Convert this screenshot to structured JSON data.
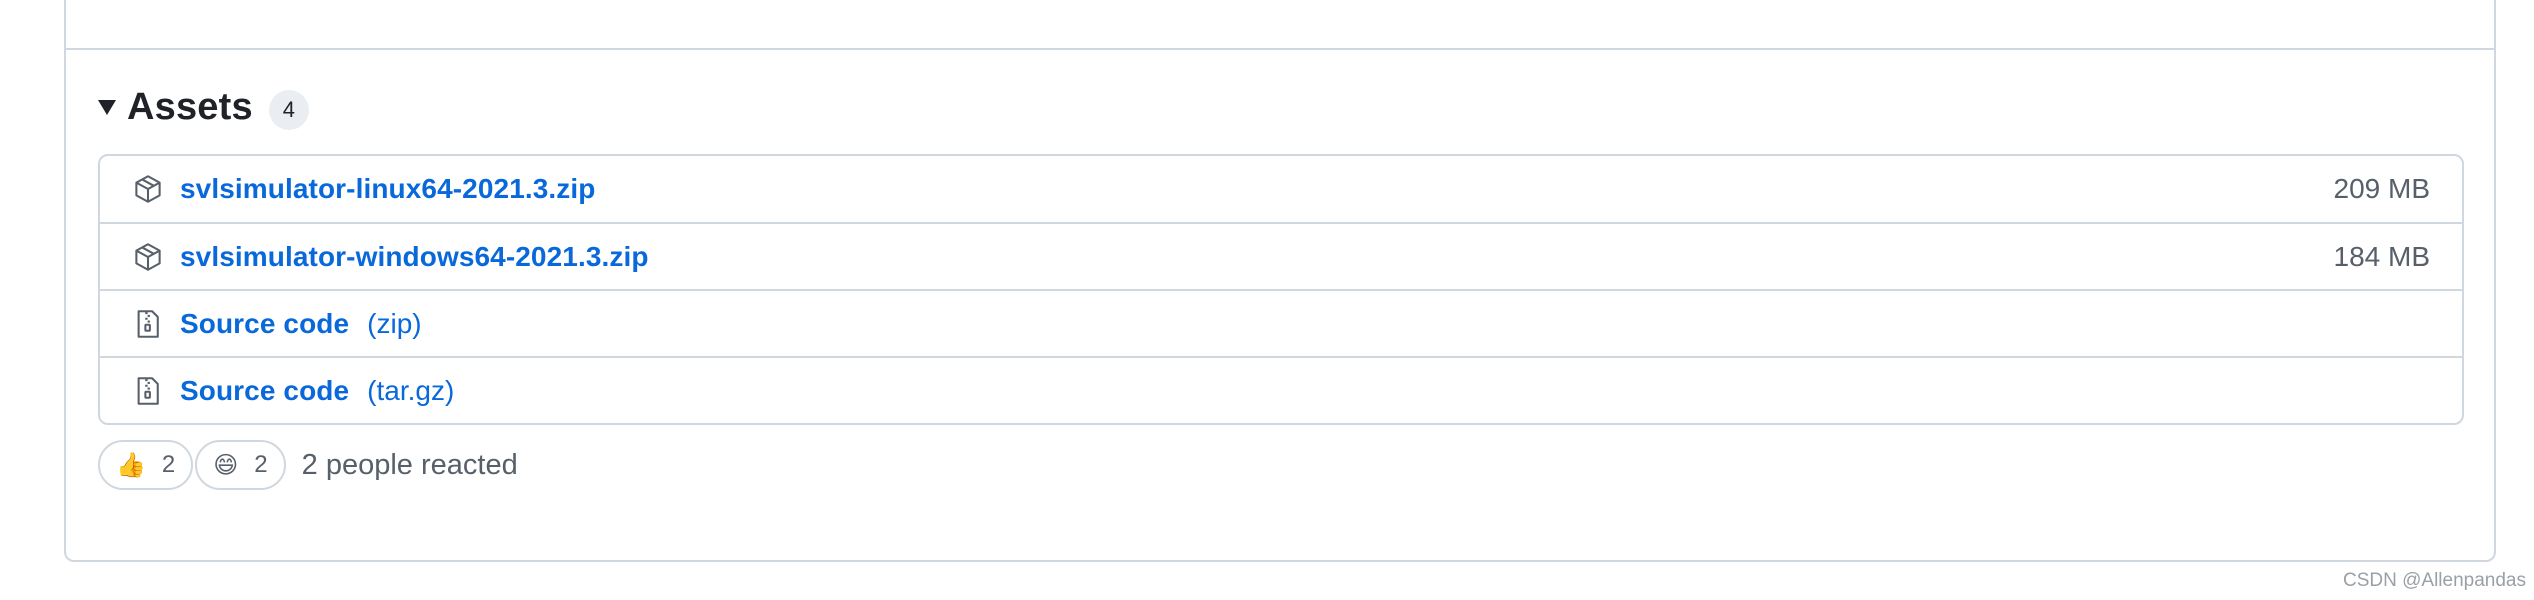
{
  "assets": {
    "title": "Assets",
    "count": "4",
    "items": [
      {
        "name": "svlsimulator-linux64-2021.3.zip",
        "ext": "",
        "size": "209 MB",
        "icon": "package-icon"
      },
      {
        "name": "svlsimulator-windows64-2021.3.zip",
        "ext": "",
        "size": "184 MB",
        "icon": "package-icon"
      },
      {
        "name": "Source code",
        "ext": "(zip)",
        "size": "",
        "icon": "file-zip-icon"
      },
      {
        "name": "Source code",
        "ext": "(tar.gz)",
        "size": "",
        "icon": "file-zip-icon"
      }
    ]
  },
  "reactions": {
    "items": [
      {
        "emoji": "👍",
        "count": "2",
        "icon": "thumbs-up-icon"
      },
      {
        "emoji": "😄",
        "count": "2",
        "icon": "smile-icon"
      }
    ],
    "summary": "2 people reacted"
  },
  "watermark": "CSDN @Allenpandas",
  "colors": {
    "link": "#0969da",
    "border": "#d0d7de",
    "muted": "#57606a"
  }
}
